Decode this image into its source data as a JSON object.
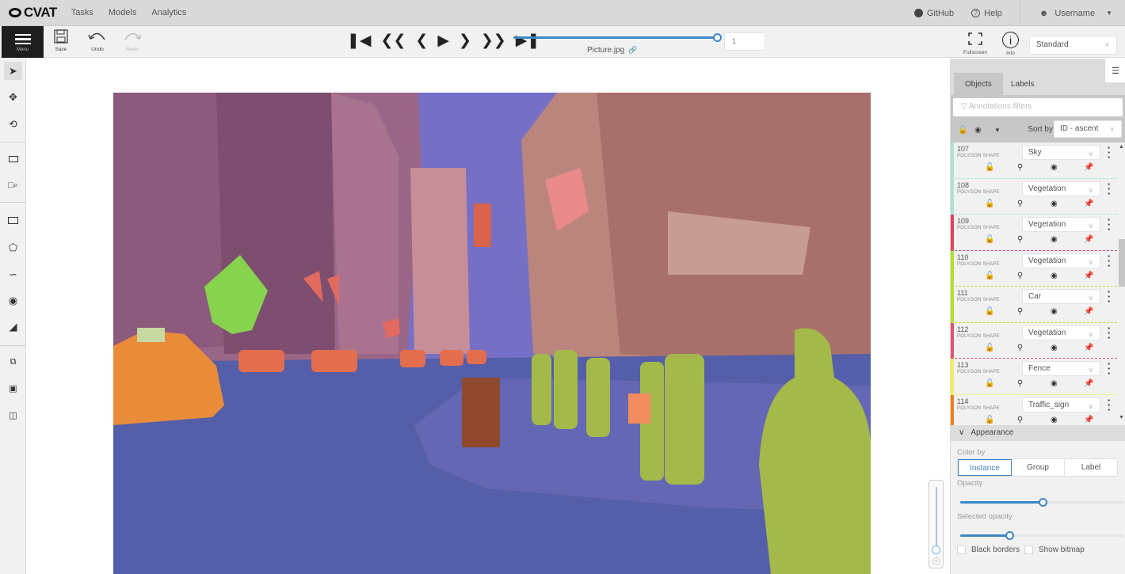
{
  "app": {
    "logo": "CVAT",
    "nav": [
      "Tasks",
      "Models",
      "Analytics"
    ],
    "github": "GitHub",
    "help": "Help",
    "username": "Username"
  },
  "toolbar": {
    "menu_label": "Menu",
    "save_label": "Save",
    "undo_label": "Undo",
    "redo_label": "Redo",
    "frame_number": "1",
    "filename": "Picture.jpg",
    "fullscreen_label": "Fullscreen",
    "info_label": "Info",
    "workspace": "Standard",
    "player_progress_percent": 100
  },
  "left_tools": [
    {
      "name": "cursor-icon"
    },
    {
      "name": "move-icon"
    },
    {
      "name": "rotate-icon"
    },
    {
      "name": "fit-image-icon"
    },
    {
      "name": "zoom-region-icon"
    },
    {
      "name": "rectangle-icon"
    },
    {
      "name": "polygon-icon"
    },
    {
      "name": "polyline-icon"
    },
    {
      "name": "points-icon"
    },
    {
      "name": "tag-icon"
    },
    {
      "name": "merge-icon"
    },
    {
      "name": "group-icon"
    },
    {
      "name": "split-icon"
    }
  ],
  "sidebar": {
    "tabs": [
      "Objects",
      "Labels"
    ],
    "filter_placeholder": "Annotations filters",
    "sort_by_label": "Sort by",
    "sort_value": "ID - ascent",
    "objects": [
      {
        "id": "107",
        "type": "POLYGON SHAPE",
        "label": "Sky",
        "color": "#a8e6cf"
      },
      {
        "id": "108",
        "type": "POLYGON SHAPE",
        "label": "Vegetation",
        "color": "#a8e6cf"
      },
      {
        "id": "109",
        "type": "POLYGON SHAPE",
        "label": "Vegetation",
        "color": "#e0455f"
      },
      {
        "id": "110",
        "type": "POLYGON SHAPE",
        "label": "Vegetation",
        "color": "#b3e02e"
      },
      {
        "id": "111",
        "type": "POLYGON SHAPE",
        "label": "Car",
        "color": "#b3e02e"
      },
      {
        "id": "112",
        "type": "POLYGON SHAPE",
        "label": "Vegetation",
        "color": "#e0556f"
      },
      {
        "id": "113",
        "type": "POLYGON SHAPE",
        "label": "Fence",
        "color": "#f0ef5c"
      },
      {
        "id": "114",
        "type": "POLYGON SHAPE",
        "label": "Traffic_sign",
        "color": "#ef7e1e"
      }
    ],
    "appearance": {
      "title": "Appearance",
      "color_by_label": "Color by",
      "color_by_options": [
        "Instance",
        "Group",
        "Label"
      ],
      "color_by_selected": "Instance",
      "opacity_label": "Opacity",
      "opacity_value": 0.5,
      "selected_opacity_label": "Selected opacity",
      "selected_opacity_value": 0.3,
      "black_borders_label": "Black borders",
      "show_bitmap_label": "Show bitmap"
    }
  }
}
